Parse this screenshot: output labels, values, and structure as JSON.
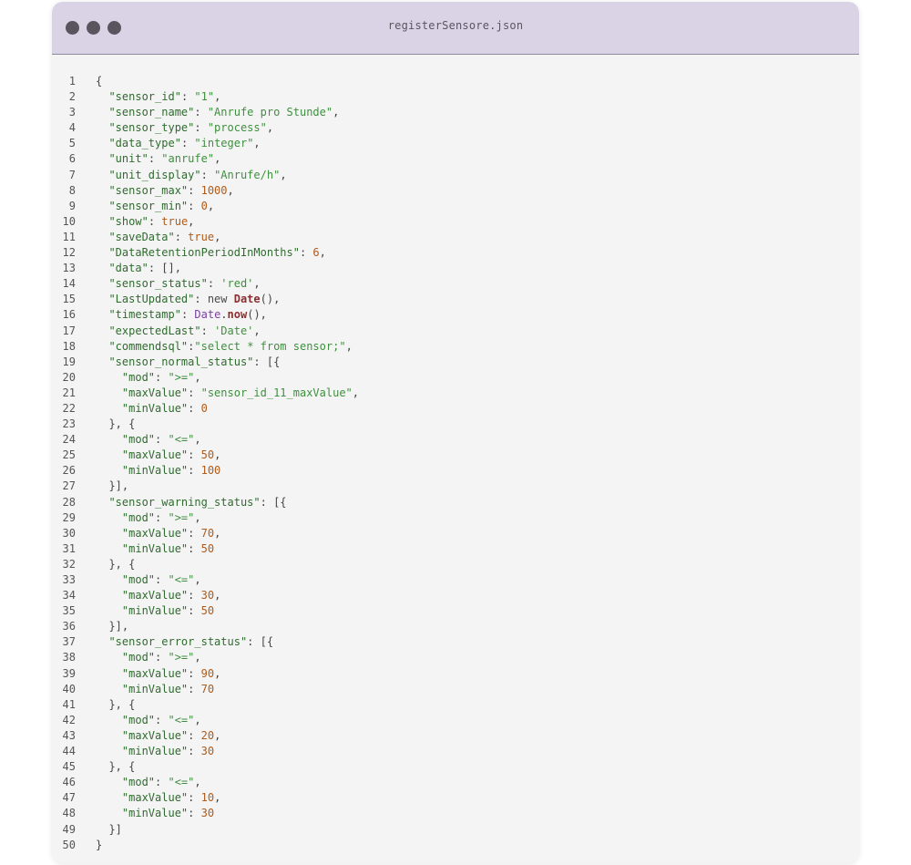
{
  "window": {
    "title": "registerSensore.json"
  },
  "code": {
    "lines": [
      [
        [
          "p",
          "{"
        ]
      ],
      [
        [
          "p",
          "  "
        ],
        [
          "k",
          "\"sensor_id\""
        ],
        [
          "p",
          ": "
        ],
        [
          "s",
          "\"1\""
        ],
        [
          "p",
          ","
        ]
      ],
      [
        [
          "p",
          "  "
        ],
        [
          "k",
          "\"sensor_name\""
        ],
        [
          "p",
          ": "
        ],
        [
          "s",
          "\"Anrufe pro Stunde\""
        ],
        [
          "p",
          ","
        ]
      ],
      [
        [
          "p",
          "  "
        ],
        [
          "k",
          "\"sensor_type\""
        ],
        [
          "p",
          ": "
        ],
        [
          "s",
          "\"process\""
        ],
        [
          "p",
          ","
        ]
      ],
      [
        [
          "p",
          "  "
        ],
        [
          "k",
          "\"data_type\""
        ],
        [
          "p",
          ": "
        ],
        [
          "s",
          "\"integer\""
        ],
        [
          "p",
          ","
        ]
      ],
      [
        [
          "p",
          "  "
        ],
        [
          "k",
          "\"unit\""
        ],
        [
          "p",
          ": "
        ],
        [
          "s",
          "\"anrufe\""
        ],
        [
          "p",
          ","
        ]
      ],
      [
        [
          "p",
          "  "
        ],
        [
          "k",
          "\"unit_display\""
        ],
        [
          "p",
          ": "
        ],
        [
          "s",
          "\"Anrufe/h\""
        ],
        [
          "p",
          ","
        ]
      ],
      [
        [
          "p",
          "  "
        ],
        [
          "k",
          "\"sensor_max\""
        ],
        [
          "p",
          ": "
        ],
        [
          "n",
          "1000"
        ],
        [
          "p",
          ","
        ]
      ],
      [
        [
          "p",
          "  "
        ],
        [
          "k",
          "\"sensor_min\""
        ],
        [
          "p",
          ": "
        ],
        [
          "n",
          "0"
        ],
        [
          "p",
          ","
        ]
      ],
      [
        [
          "p",
          "  "
        ],
        [
          "k",
          "\"show\""
        ],
        [
          "p",
          ": "
        ],
        [
          "n",
          "true"
        ],
        [
          "p",
          ","
        ]
      ],
      [
        [
          "p",
          "  "
        ],
        [
          "k",
          "\"saveData\""
        ],
        [
          "p",
          ": "
        ],
        [
          "n",
          "true"
        ],
        [
          "p",
          ","
        ]
      ],
      [
        [
          "p",
          "  "
        ],
        [
          "k",
          "\"DataRetentionPeriodInMonths\""
        ],
        [
          "p",
          ": "
        ],
        [
          "n",
          "6"
        ],
        [
          "p",
          ","
        ]
      ],
      [
        [
          "p",
          "  "
        ],
        [
          "k",
          "\"data\""
        ],
        [
          "p",
          ": [],"
        ]
      ],
      [
        [
          "p",
          "  "
        ],
        [
          "k",
          "\"sensor_status\""
        ],
        [
          "p",
          ": "
        ],
        [
          "s",
          "'red'"
        ],
        [
          "p",
          ","
        ]
      ],
      [
        [
          "p",
          "  "
        ],
        [
          "k",
          "\"LastUpdated\""
        ],
        [
          "p",
          ": "
        ],
        [
          "kw",
          "new "
        ],
        [
          "fn",
          "Date"
        ],
        [
          "p",
          "(),"
        ]
      ],
      [
        [
          "p",
          "  "
        ],
        [
          "k",
          "\"timestamp\""
        ],
        [
          "p",
          ": "
        ],
        [
          "ob",
          "Date"
        ],
        [
          "p",
          "."
        ],
        [
          "fn",
          "now"
        ],
        [
          "p",
          "(),"
        ]
      ],
      [
        [
          "p",
          "  "
        ],
        [
          "k",
          "\"expectedLast\""
        ],
        [
          "p",
          ": "
        ],
        [
          "s",
          "'Date'"
        ],
        [
          "p",
          ","
        ]
      ],
      [
        [
          "p",
          "  "
        ],
        [
          "k",
          "\"commendsql\""
        ],
        [
          "p",
          ":"
        ],
        [
          "s",
          "\"select * from sensor;\""
        ],
        [
          "p",
          ","
        ]
      ],
      [
        [
          "p",
          "  "
        ],
        [
          "k",
          "\"sensor_normal_status\""
        ],
        [
          "p",
          ": [{"
        ]
      ],
      [
        [
          "p",
          "    "
        ],
        [
          "k",
          "\"mod\""
        ],
        [
          "p",
          ": "
        ],
        [
          "s",
          "\">=\""
        ],
        [
          "p",
          ","
        ]
      ],
      [
        [
          "p",
          "    "
        ],
        [
          "k",
          "\"maxValue\""
        ],
        [
          "p",
          ": "
        ],
        [
          "s",
          "\"sensor_id_11_maxValue\""
        ],
        [
          "p",
          ","
        ]
      ],
      [
        [
          "p",
          "    "
        ],
        [
          "k",
          "\"minValue\""
        ],
        [
          "p",
          ": "
        ],
        [
          "n",
          "0"
        ]
      ],
      [
        [
          "p",
          "  }, {"
        ]
      ],
      [
        [
          "p",
          "    "
        ],
        [
          "k",
          "\"mod\""
        ],
        [
          "p",
          ": "
        ],
        [
          "s",
          "\"<=\""
        ],
        [
          "p",
          ","
        ]
      ],
      [
        [
          "p",
          "    "
        ],
        [
          "k",
          "\"maxValue\""
        ],
        [
          "p",
          ": "
        ],
        [
          "n",
          "50"
        ],
        [
          "p",
          ","
        ]
      ],
      [
        [
          "p",
          "    "
        ],
        [
          "k",
          "\"minValue\""
        ],
        [
          "p",
          ": "
        ],
        [
          "n",
          "100"
        ]
      ],
      [
        [
          "p",
          "  }],"
        ]
      ],
      [
        [
          "p",
          "  "
        ],
        [
          "k",
          "\"sensor_warning_status\""
        ],
        [
          "p",
          ": [{"
        ]
      ],
      [
        [
          "p",
          "    "
        ],
        [
          "k",
          "\"mod\""
        ],
        [
          "p",
          ": "
        ],
        [
          "s",
          "\">=\""
        ],
        [
          "p",
          ","
        ]
      ],
      [
        [
          "p",
          "    "
        ],
        [
          "k",
          "\"maxValue\""
        ],
        [
          "p",
          ": "
        ],
        [
          "n",
          "70"
        ],
        [
          "p",
          ","
        ]
      ],
      [
        [
          "p",
          "    "
        ],
        [
          "k",
          "\"minValue\""
        ],
        [
          "p",
          ": "
        ],
        [
          "n",
          "50"
        ]
      ],
      [
        [
          "p",
          "  }, {"
        ]
      ],
      [
        [
          "p",
          "    "
        ],
        [
          "k",
          "\"mod\""
        ],
        [
          "p",
          ": "
        ],
        [
          "s",
          "\"<=\""
        ],
        [
          "p",
          ","
        ]
      ],
      [
        [
          "p",
          "    "
        ],
        [
          "k",
          "\"maxValue\""
        ],
        [
          "p",
          ": "
        ],
        [
          "n",
          "30"
        ],
        [
          "p",
          ","
        ]
      ],
      [
        [
          "p",
          "    "
        ],
        [
          "k",
          "\"minValue\""
        ],
        [
          "p",
          ": "
        ],
        [
          "n",
          "50"
        ]
      ],
      [
        [
          "p",
          "  }],"
        ]
      ],
      [
        [
          "p",
          "  "
        ],
        [
          "k",
          "\"sensor_error_status\""
        ],
        [
          "p",
          ": [{"
        ]
      ],
      [
        [
          "p",
          "    "
        ],
        [
          "k",
          "\"mod\""
        ],
        [
          "p",
          ": "
        ],
        [
          "s",
          "\">=\""
        ],
        [
          "p",
          ","
        ]
      ],
      [
        [
          "p",
          "    "
        ],
        [
          "k",
          "\"maxValue\""
        ],
        [
          "p",
          ": "
        ],
        [
          "n",
          "90"
        ],
        [
          "p",
          ","
        ]
      ],
      [
        [
          "p",
          "    "
        ],
        [
          "k",
          "\"minValue\""
        ],
        [
          "p",
          ": "
        ],
        [
          "n",
          "70"
        ]
      ],
      [
        [
          "p",
          "  }, {"
        ]
      ],
      [
        [
          "p",
          "    "
        ],
        [
          "k",
          "\"mod\""
        ],
        [
          "p",
          ": "
        ],
        [
          "s",
          "\"<=\""
        ],
        [
          "p",
          ","
        ]
      ],
      [
        [
          "p",
          "    "
        ],
        [
          "k",
          "\"maxValue\""
        ],
        [
          "p",
          ": "
        ],
        [
          "n",
          "20"
        ],
        [
          "p",
          ","
        ]
      ],
      [
        [
          "p",
          "    "
        ],
        [
          "k",
          "\"minValue\""
        ],
        [
          "p",
          ": "
        ],
        [
          "n",
          "30"
        ]
      ],
      [
        [
          "p",
          "  }, {"
        ]
      ],
      [
        [
          "p",
          "    "
        ],
        [
          "k",
          "\"mod\""
        ],
        [
          "p",
          ": "
        ],
        [
          "s",
          "\"<=\""
        ],
        [
          "p",
          ","
        ]
      ],
      [
        [
          "p",
          "    "
        ],
        [
          "k",
          "\"maxValue\""
        ],
        [
          "p",
          ": "
        ],
        [
          "n",
          "10"
        ],
        [
          "p",
          ","
        ]
      ],
      [
        [
          "p",
          "    "
        ],
        [
          "k",
          "\"minValue\""
        ],
        [
          "p",
          ": "
        ],
        [
          "n",
          "30"
        ]
      ],
      [
        [
          "p",
          "  }]"
        ]
      ],
      [
        [
          "p",
          "}"
        ]
      ]
    ]
  }
}
